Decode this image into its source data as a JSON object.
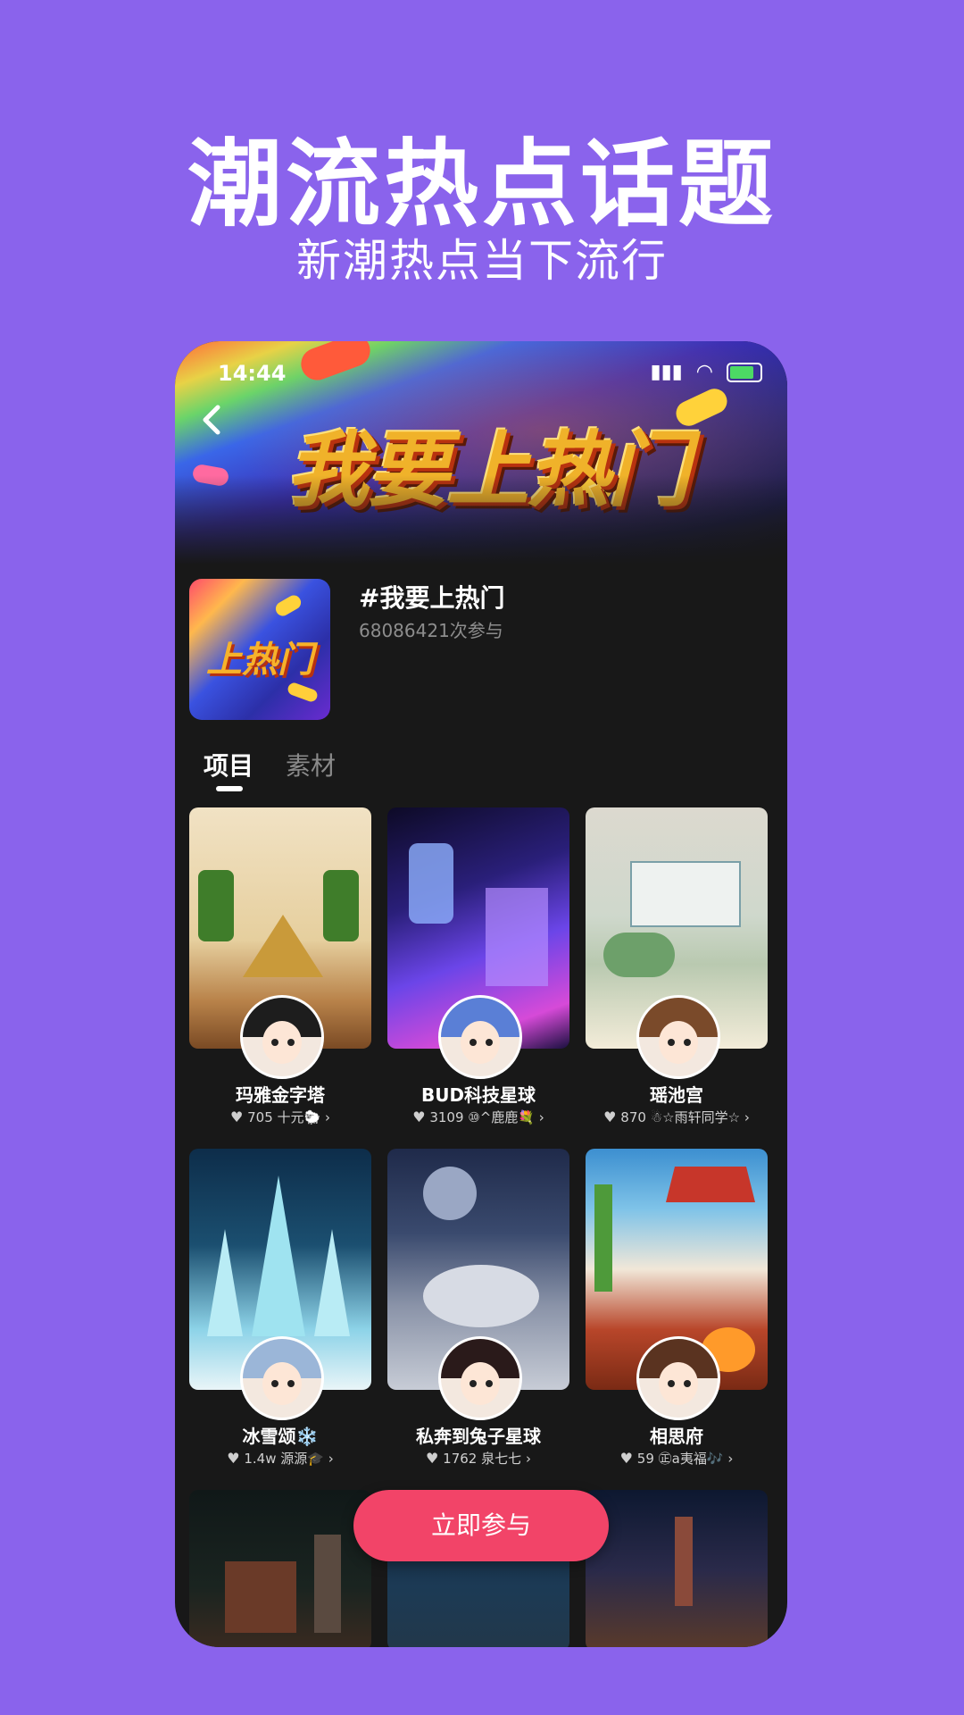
{
  "promo": {
    "title": "潮流热点话题",
    "subtitle": "新潮热点当下流行"
  },
  "status_bar": {
    "time": "14:44",
    "icons": [
      "signal-icon",
      "wifi-icon",
      "battery-icon"
    ]
  },
  "banner": {
    "art_text": "我要上热门"
  },
  "topic": {
    "thumb_text": "上热门",
    "name": "#我要上热门",
    "participants": "68086421次参与"
  },
  "tabs": [
    {
      "label": "项目",
      "active": true
    },
    {
      "label": "素材",
      "active": false
    }
  ],
  "cards": [
    {
      "title": "玛雅金字塔",
      "likes": "705",
      "author": "十元🐑"
    },
    {
      "title": "BUD科技星球",
      "likes": "3109",
      "author": "⑩^鹿鹿💐"
    },
    {
      "title": "瑶池宫",
      "likes": "870",
      "author": "☃☆雨轩同学☆"
    },
    {
      "title": "冰雪颂❄️",
      "likes": "1.4w",
      "author": "源源🎓"
    },
    {
      "title": "私奔到兔子星球",
      "likes": "1762",
      "author": "泉七七"
    },
    {
      "title": "相思府",
      "likes": "59",
      "author": "㊣a夷福🎶"
    }
  ],
  "cta": {
    "label": "立即参与"
  },
  "colors": {
    "background": "#8a63ec",
    "card_bg": "#181818",
    "cta": "#f24468"
  }
}
